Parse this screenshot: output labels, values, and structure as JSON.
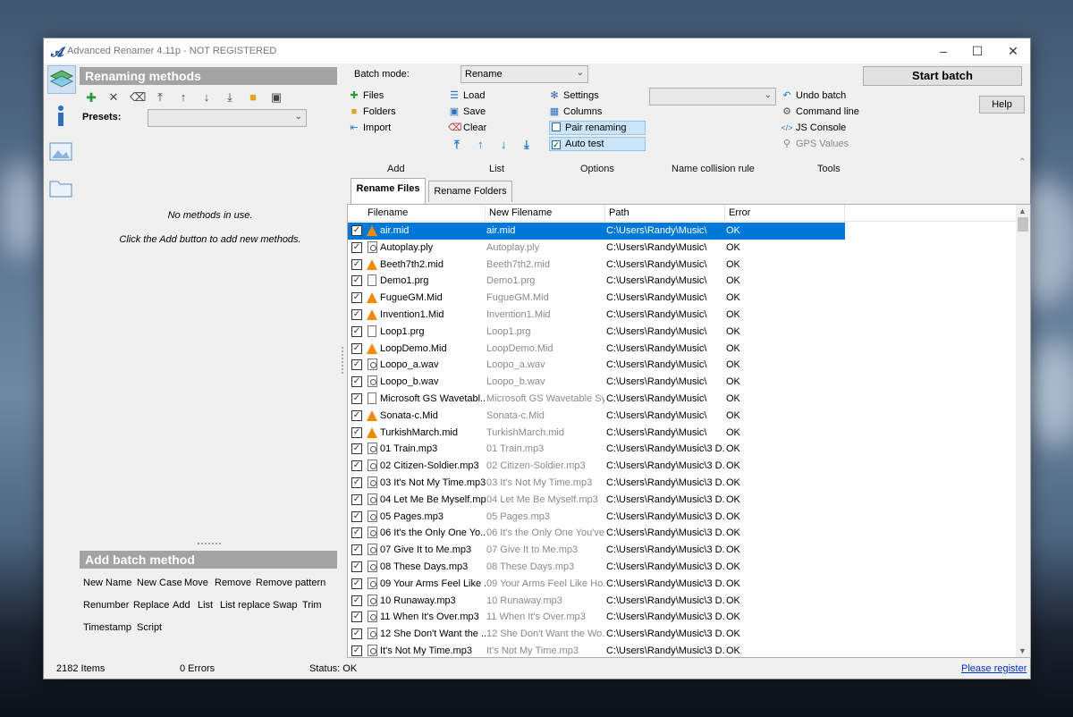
{
  "window": {
    "title": "Advanced Renamer 4.11p - NOT REGISTERED"
  },
  "left": {
    "renaming_header": "Renaming methods",
    "presets_label": "Presets:",
    "presets_value": "",
    "empty_line1": "No methods in use.",
    "empty_line2": "Click the Add button to add new methods.",
    "add_header": "Add batch method",
    "methods": [
      "New Name",
      "New Case",
      "Move",
      "Remove",
      "Remove pattern",
      "Renumber",
      "Replace",
      "Add",
      "List",
      "List replace",
      "Swap",
      "Trim",
      "Timestamp",
      "Script"
    ]
  },
  "top": {
    "batch_mode_label": "Batch mode:",
    "batch_mode_value": "Rename",
    "add": {
      "files": "Files",
      "folders": "Folders",
      "import": "Import",
      "group": "Add"
    },
    "list": {
      "load": "Load",
      "save": "Save",
      "clear": "Clear",
      "group": "List"
    },
    "options": {
      "settings": "Settings",
      "columns": "Columns",
      "pair": "Pair renaming",
      "auto": "Auto test",
      "group": "Options"
    },
    "collision": {
      "group": "Name collision rule",
      "value": ""
    },
    "tools": {
      "undo": "Undo batch",
      "cmd": "Command line",
      "js": "JS Console",
      "gps": "GPS Values",
      "group": "Tools"
    },
    "start_batch": "Start batch",
    "help": "Help"
  },
  "tabs": {
    "files": "Rename Files",
    "folders": "Rename Folders"
  },
  "columns": [
    "Filename",
    "New Filename",
    "Path",
    "Error"
  ],
  "rows": [
    {
      "fn": "air.mid",
      "nf": "air.mid",
      "path": "C:\\Users\\Randy\\Music\\",
      "err": "OK",
      "icon": "vlc"
    },
    {
      "fn": "Autoplay.ply",
      "nf": "Autoplay.ply",
      "path": "C:\\Users\\Randy\\Music\\",
      "err": "OK",
      "icon": "disc"
    },
    {
      "fn": "Beeth7th2.mid",
      "nf": "Beeth7th2.mid",
      "path": "C:\\Users\\Randy\\Music\\",
      "err": "OK",
      "icon": "vlc"
    },
    {
      "fn": "Demo1.prg",
      "nf": "Demo1.prg",
      "path": "C:\\Users\\Randy\\Music\\",
      "err": "OK",
      "icon": "doc"
    },
    {
      "fn": "FugueGM.Mid",
      "nf": "FugueGM.Mid",
      "path": "C:\\Users\\Randy\\Music\\",
      "err": "OK",
      "icon": "vlc"
    },
    {
      "fn": "Invention1.Mid",
      "nf": "Invention1.Mid",
      "path": "C:\\Users\\Randy\\Music\\",
      "err": "OK",
      "icon": "vlc"
    },
    {
      "fn": "Loop1.prg",
      "nf": "Loop1.prg",
      "path": "C:\\Users\\Randy\\Music\\",
      "err": "OK",
      "icon": "doc"
    },
    {
      "fn": "LoopDemo.Mid",
      "nf": "LoopDemo.Mid",
      "path": "C:\\Users\\Randy\\Music\\",
      "err": "OK",
      "icon": "vlc"
    },
    {
      "fn": "Loopo_a.wav",
      "nf": "Loopo_a.wav",
      "path": "C:\\Users\\Randy\\Music\\",
      "err": "OK",
      "icon": "disc"
    },
    {
      "fn": "Loopo_b.wav",
      "nf": "Loopo_b.wav",
      "path": "C:\\Users\\Randy\\Music\\",
      "err": "OK",
      "icon": "disc"
    },
    {
      "fn": "Microsoft GS Wavetabl...",
      "nf": "Microsoft GS Wavetable Sy...",
      "path": "C:\\Users\\Randy\\Music\\",
      "err": "OK",
      "icon": "doc"
    },
    {
      "fn": "Sonata-c.Mid",
      "nf": "Sonata-c.Mid",
      "path": "C:\\Users\\Randy\\Music\\",
      "err": "OK",
      "icon": "vlc"
    },
    {
      "fn": "TurkishMarch.mid",
      "nf": "TurkishMarch.mid",
      "path": "C:\\Users\\Randy\\Music\\",
      "err": "OK",
      "icon": "vlc"
    },
    {
      "fn": "01 Train.mp3",
      "nf": "01 Train.mp3",
      "path": "C:\\Users\\Randy\\Music\\3 D...",
      "err": "OK",
      "icon": "disc"
    },
    {
      "fn": "02 Citizen-Soldier.mp3",
      "nf": "02 Citizen-Soldier.mp3",
      "path": "C:\\Users\\Randy\\Music\\3 D...",
      "err": "OK",
      "icon": "disc"
    },
    {
      "fn": "03 It's Not My Time.mp3",
      "nf": "03 It's Not My Time.mp3",
      "path": "C:\\Users\\Randy\\Music\\3 D...",
      "err": "OK",
      "icon": "disc"
    },
    {
      "fn": "04 Let Me Be Myself.mp3",
      "nf": "04 Let Me Be Myself.mp3",
      "path": "C:\\Users\\Randy\\Music\\3 D...",
      "err": "OK",
      "icon": "disc"
    },
    {
      "fn": "05 Pages.mp3",
      "nf": "05 Pages.mp3",
      "path": "C:\\Users\\Randy\\Music\\3 D...",
      "err": "OK",
      "icon": "disc"
    },
    {
      "fn": "06 It's the Only One Yo...",
      "nf": "06 It's the Only One You've...",
      "path": "C:\\Users\\Randy\\Music\\3 D...",
      "err": "OK",
      "icon": "disc"
    },
    {
      "fn": "07 Give It to Me.mp3",
      "nf": "07 Give It to Me.mp3",
      "path": "C:\\Users\\Randy\\Music\\3 D...",
      "err": "OK",
      "icon": "disc"
    },
    {
      "fn": "08 These Days.mp3",
      "nf": "08 These Days.mp3",
      "path": "C:\\Users\\Randy\\Music\\3 D...",
      "err": "OK",
      "icon": "disc"
    },
    {
      "fn": "09 Your Arms Feel Like ...",
      "nf": "09 Your Arms Feel Like Ho...",
      "path": "C:\\Users\\Randy\\Music\\3 D...",
      "err": "OK",
      "icon": "disc"
    },
    {
      "fn": "10 Runaway.mp3",
      "nf": "10 Runaway.mp3",
      "path": "C:\\Users\\Randy\\Music\\3 D...",
      "err": "OK",
      "icon": "disc"
    },
    {
      "fn": "11 When It's Over.mp3",
      "nf": "11 When It's Over.mp3",
      "path": "C:\\Users\\Randy\\Music\\3 D...",
      "err": "OK",
      "icon": "disc"
    },
    {
      "fn": "12 She Don't Want the ...",
      "nf": "12 She Don't Want the Wo...",
      "path": "C:\\Users\\Randy\\Music\\3 D...",
      "err": "OK",
      "icon": "disc"
    },
    {
      "fn": "It's Not My Time.mp3",
      "nf": "It's Not My Time.mp3",
      "path": "C:\\Users\\Randy\\Music\\3 D...",
      "err": "OK",
      "icon": "disc"
    }
  ],
  "status": {
    "items": "2182 Items",
    "errors": "0 Errors",
    "status": "Status: OK",
    "register": "Please register"
  },
  "colors": {
    "selection": "#0078d7",
    "section_header": "#a3a3a3",
    "link": "#0033cc"
  }
}
